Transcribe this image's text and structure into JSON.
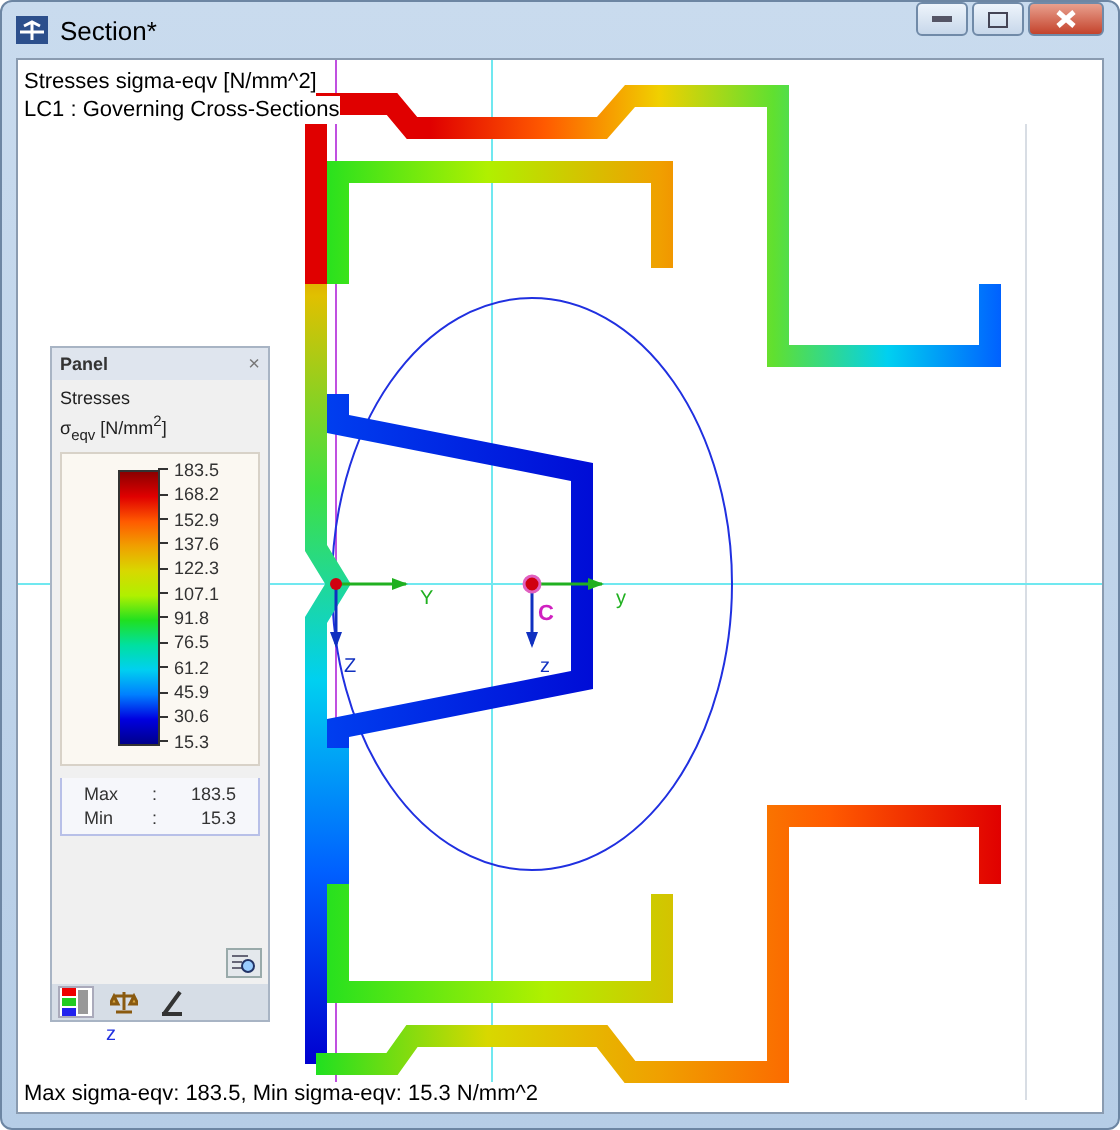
{
  "window": {
    "title": "Section*"
  },
  "info": [
    "Stresses sigma-eqv [N/mm^2]",
    "LC1 : Governing Cross-Sections"
  ],
  "axes": [
    {
      "kind": "principal",
      "horizontal": "Y",
      "vertical": "Z"
    },
    {
      "kind": "centroid",
      "horizontal": "y",
      "vertical": "z",
      "point": "C"
    }
  ],
  "panel": {
    "title": "Panel",
    "close": "×",
    "heading": "Stresses",
    "unit": "σ$_{eqv}$ [N/mm$^{2}$]",
    "legend": [
      "183.5",
      "168.2",
      "152.9",
      "137.6",
      "122.3",
      "107.1",
      "91.8",
      "76.5",
      "61.2",
      "45.9",
      "30.6",
      "15.3"
    ],
    "extremes": [
      {
        "label": "Max",
        "separator": ":",
        "value": "183.5"
      },
      {
        "label": "Min",
        "separator": ":",
        "value": "15.3"
      }
    ],
    "tabs": [
      {
        "kind": "colors",
        "selected": true
      },
      {
        "kind": "scale",
        "selected": false
      },
      {
        "kind": "tools",
        "selected": false
      }
    ]
  },
  "canvas_label": "z",
  "status": "Max sigma-eqv: 183.5, Min sigma-eqv: 15.3 N/mm^2"
}
